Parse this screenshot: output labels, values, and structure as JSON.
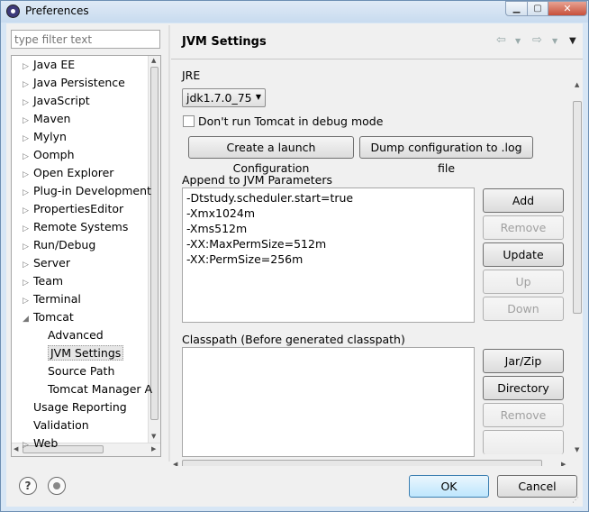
{
  "window": {
    "title": "Preferences"
  },
  "filter": {
    "placeholder": "type filter text"
  },
  "tree": {
    "items": [
      {
        "label": "Java EE",
        "toggle": "▷"
      },
      {
        "label": "Java Persistence",
        "toggle": "▷"
      },
      {
        "label": "JavaScript",
        "toggle": "▷"
      },
      {
        "label": "Maven",
        "toggle": "▷"
      },
      {
        "label": "Mylyn",
        "toggle": "▷"
      },
      {
        "label": "Oomph",
        "toggle": "▷"
      },
      {
        "label": "Open Explorer",
        "toggle": "▷"
      },
      {
        "label": "Plug-in Development",
        "toggle": "▷"
      },
      {
        "label": "PropertiesEditor",
        "toggle": "▷"
      },
      {
        "label": "Remote Systems",
        "toggle": "▷"
      },
      {
        "label": "Run/Debug",
        "toggle": "▷"
      },
      {
        "label": "Server",
        "toggle": "▷"
      },
      {
        "label": "Team",
        "toggle": "▷"
      },
      {
        "label": "Terminal",
        "toggle": "▷"
      },
      {
        "label": "Tomcat",
        "toggle": "◢"
      },
      {
        "label": "Advanced",
        "toggle": ""
      },
      {
        "label": "JVM Settings",
        "toggle": ""
      },
      {
        "label": "Source Path",
        "toggle": ""
      },
      {
        "label": "Tomcat Manager A",
        "toggle": ""
      },
      {
        "label": "Usage Reporting",
        "toggle": ""
      },
      {
        "label": "Validation",
        "toggle": ""
      },
      {
        "label": "Web",
        "toggle": "▷"
      }
    ],
    "selected": "JVM Settings"
  },
  "page": {
    "title": "JVM Settings",
    "jre_label": "JRE",
    "jre_value": "jdk1.7.0_75",
    "debug_checkbox_label": "Don't run Tomcat in debug mode",
    "create_launch_button": "Create a launch Configuration",
    "dump_config_button": "Dump configuration to .log file",
    "append_label": "Append to JVM Parameters",
    "jvm_params": [
      "-Dtstudy.scheduler.start=true",
      "-Xmx1024m",
      "-Xms512m",
      "-XX:MaxPermSize=512m",
      "-XX:PermSize=256m"
    ],
    "param_buttons": {
      "add": "Add",
      "remove": "Remove",
      "update": "Update",
      "up": "Up",
      "down": "Down"
    },
    "classpath_label": "Classpath (Before generated classpath)",
    "classpath_buttons": {
      "jarzip": "Jar/Zip",
      "directory": "Directory",
      "remove": "Remove"
    }
  },
  "dialog": {
    "ok": "OK",
    "cancel": "Cancel"
  }
}
